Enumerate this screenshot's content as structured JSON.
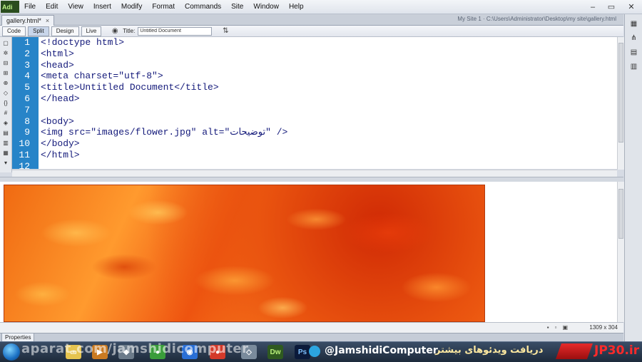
{
  "app": {
    "logo_text": "Adi",
    "menu": [
      "File",
      "Edit",
      "View",
      "Insert",
      "Modify",
      "Format",
      "Commands",
      "Site",
      "Window",
      "Help"
    ]
  },
  "tab": {
    "name": "gallery.html*",
    "close": "×"
  },
  "doc_path": "My Site 1 · C:\\Users\\Administrator\\Desktop\\my site\\gallery.html",
  "window_controls": {
    "minimize": "–",
    "restore": "▭",
    "close": "✕"
  },
  "toolbar": {
    "views": [
      "Code",
      "Split",
      "Design",
      "Live"
    ],
    "active_view": "Split",
    "title_label": "Title:",
    "title_value": "Untitled Document"
  },
  "code": {
    "line_numbers": [
      "1",
      "2",
      "3",
      "4",
      "5",
      "6",
      "7",
      "8",
      "9",
      "10",
      "11",
      "12"
    ],
    "lines": [
      "<!doctype html>",
      "<html>",
      "<head>",
      "<meta charset=\"utf-8\">",
      "<title>Untitled Document</title>",
      "</head>",
      "",
      "<body>",
      "<img src=\"images/flower.jpg\" alt=\"توضیحات\" />",
      "</body>",
      "</html>",
      ""
    ]
  },
  "status": {
    "size": "1309 x 304"
  },
  "properties": {
    "label": "Properties"
  },
  "taskbar": {
    "watermark": "aparat.com/jamshidicomputer",
    "handle": "@JamshidiComputer",
    "banner_fa": "دریافت ویدئوهای بیشتر",
    "brand": "JP30.ir",
    "dw_label": "Dw",
    "ps_label": "Ps"
  }
}
